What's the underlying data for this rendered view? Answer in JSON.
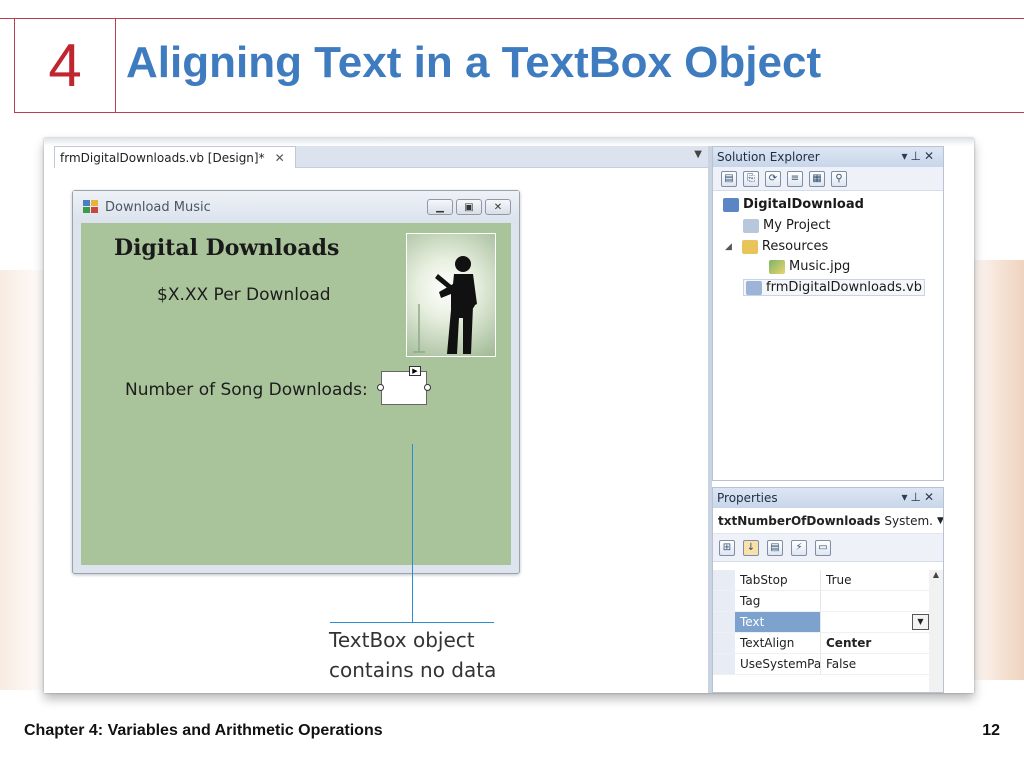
{
  "slide": {
    "chapter_number": "4",
    "title": "Aligning Text in a TextBox Object",
    "footer_left": "Chapter 4: Variables and Arithmetic Operations",
    "page_number": "12"
  },
  "designer": {
    "tab_label": "frmDigitalDownloads.vb [Design]*",
    "form": {
      "title": "Download Music",
      "heading": "Digital Downloads",
      "price": "$X.XX Per Download",
      "label": "Number of Song Downloads:"
    }
  },
  "callout": {
    "line1": "TextBox object",
    "line2": "contains no data"
  },
  "solution_explorer": {
    "title": "Solution Explorer",
    "items": [
      {
        "label": "DigitalDownload",
        "icon": "project-icon"
      },
      {
        "label": "My Project",
        "icon": "my-project-icon"
      },
      {
        "label": "Resources",
        "icon": "folder-icon"
      },
      {
        "label": "Music.jpg",
        "icon": "image-file-icon"
      },
      {
        "label": "frmDigitalDownloads.vb",
        "icon": "form-file-icon"
      }
    ]
  },
  "properties": {
    "title": "Properties",
    "object_name": "txtNumberOfDownloads",
    "object_type": "System.",
    "rows": [
      {
        "name": "TabStop",
        "value": "True"
      },
      {
        "name": "Tag",
        "value": ""
      },
      {
        "name": "Text",
        "value": ""
      },
      {
        "name": "TextAlign",
        "value": "Center"
      },
      {
        "name": "UseSystemPa",
        "value": "False"
      }
    ]
  },
  "colors": {
    "title_blue": "#3e7bbf",
    "chapter_red": "#c0262f",
    "form_green": "#a9c49a",
    "callout_blue": "#2c8dd2",
    "selection_blue": "#7da2ce"
  }
}
